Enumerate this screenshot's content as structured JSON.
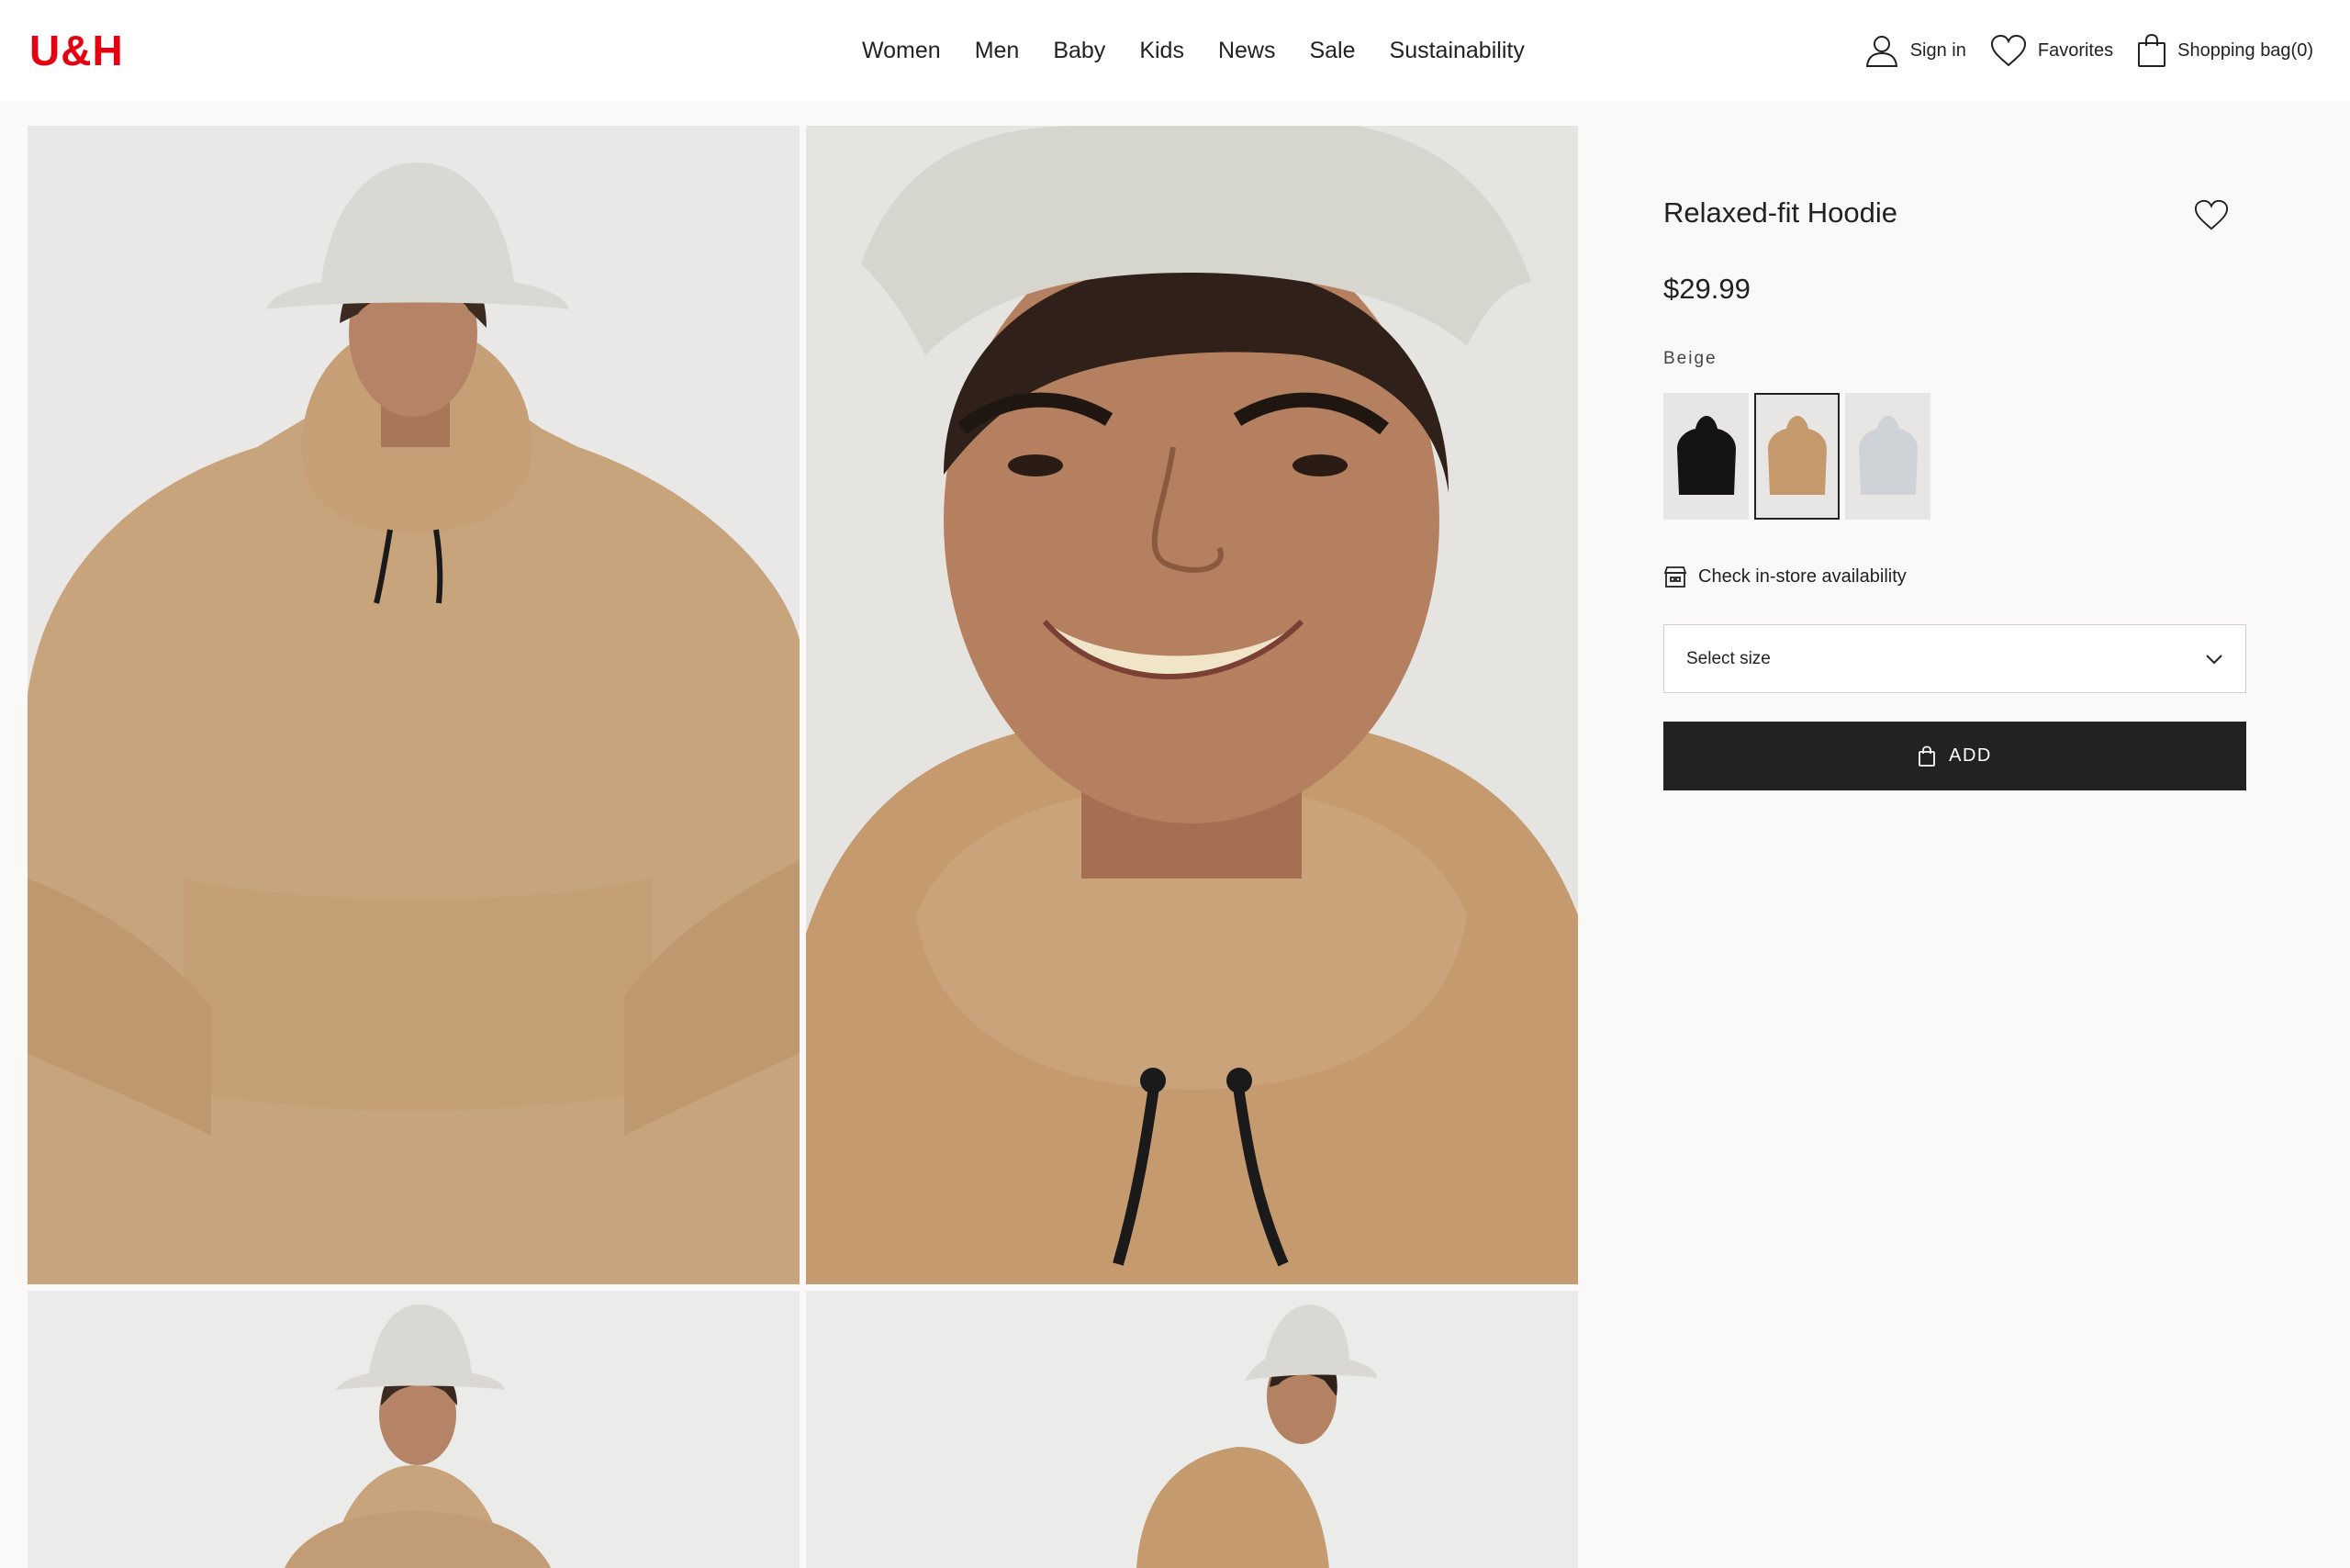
{
  "brand": {
    "logo": "U&H",
    "color": "#e50010"
  },
  "nav": {
    "items": [
      "Women",
      "Men",
      "Baby",
      "Kids",
      "News",
      "Sale",
      "Sustainability"
    ]
  },
  "utility": {
    "sign_in": "Sign in",
    "favorites": "Favorites",
    "bag": "Shopping bag(0)"
  },
  "product": {
    "title": "Relaxed-fit Hoodie",
    "price": "$29.99",
    "color_name": "Beige",
    "swatches": [
      {
        "name": "black",
        "color": "#141414"
      },
      {
        "name": "beige",
        "color": "#c49a6c",
        "selected": true
      },
      {
        "name": "light-grey",
        "color": "#cfd3d8"
      }
    ],
    "store_link": "Check in-store availability",
    "size_placeholder": "Select size",
    "add_label": "ADD"
  },
  "gallery": {
    "images": [
      "hoodie-front-hands-in-pocket",
      "face-closeup-smiling",
      "full-front-view",
      "side-view"
    ]
  }
}
